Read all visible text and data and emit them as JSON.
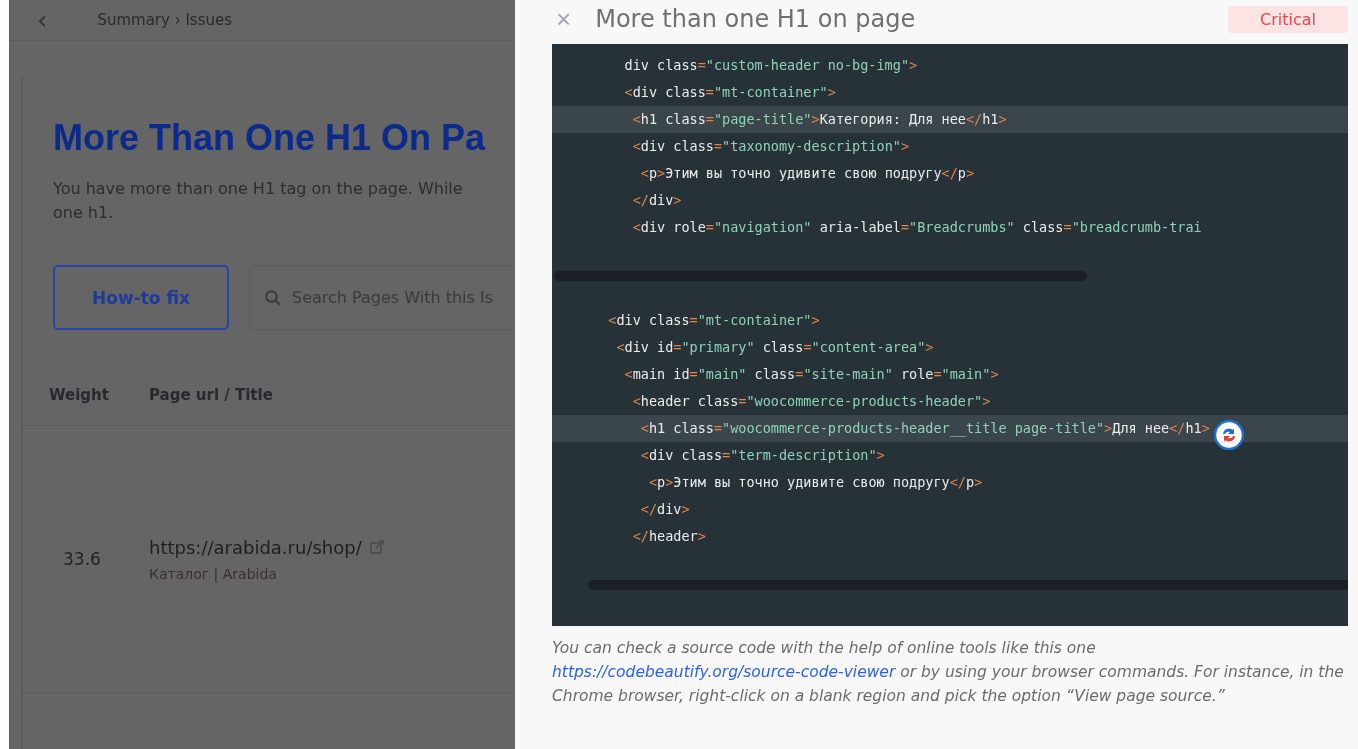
{
  "header": {
    "back": "‹",
    "breadcrumb": "Summary › Issues"
  },
  "issue": {
    "title": "More Than One H1 On Pa",
    "description": "You have more than one H1 tag on the page. While",
    "description_2": "one h1.",
    "how_to_fix": "How-to fix",
    "search": {
      "placeholder": "Search Pages With this Is"
    }
  },
  "table": {
    "columns": [
      "Weight",
      "Page url / Title"
    ],
    "rows": [
      {
        "weight": "33.6",
        "url": "https://arabida.ru/shop/",
        "title": "Каталог | Arabida"
      }
    ]
  },
  "drawer": {
    "close": "×",
    "title": "More than one H1 on page",
    "severity": "Critical",
    "code_blocks": [
      {
        "lines": [
          {
            "text": "    div class=\"custom-header no-bg-img\">",
            "highlighted": false
          },
          {
            "text": "    <div class=\"mt-container\">",
            "highlighted": false
          },
          {
            "text": "     <h1 class=\"page-title\">Категория: Для нее</h1>",
            "highlighted": true
          },
          {
            "text": "     <div class=\"taxonomy-description\">",
            "highlighted": false
          },
          {
            "text": "      <p>Этим вы точно удивите свою подругу</p>",
            "highlighted": false
          },
          {
            "text": "     </div>",
            "highlighted": false
          },
          {
            "text": "     <div role=\"navigation\" aria-label=\"Breadcrumbs\" class=\"breadcrumb-trai",
            "highlighted": false
          }
        ]
      },
      {
        "lines": [
          {
            "text": "  <div class=\"mt-container\">",
            "highlighted": false
          },
          {
            "text": "   <div id=\"primary\" class=\"content-area\">",
            "highlighted": false
          },
          {
            "text": "    <main id=\"main\" class=\"site-main\" role=\"main\">",
            "highlighted": false
          },
          {
            "text": "     <header class=\"woocommerce-products-header\">",
            "highlighted": false
          },
          {
            "text": "      <h1 class=\"woocommerce-products-header__title page-title\">Для нее</h1>",
            "highlighted": true
          },
          {
            "text": "      <div class=\"term-description\">",
            "highlighted": false
          },
          {
            "text": "       <p>Этим вы точно удивите свою подругу</p>",
            "highlighted": false
          },
          {
            "text": "      </div>",
            "highlighted": false
          },
          {
            "text": "     </header>",
            "highlighted": false
          }
        ]
      }
    ],
    "note": "You can check a source code with the help of online tools like this one",
    "link": "https://codebeautify.org/source-code-viewer",
    "note_2": "or by using your browser commands. For instance, in the Chrome browser, right-click on a blank region and pick the option “View page source.”"
  }
}
